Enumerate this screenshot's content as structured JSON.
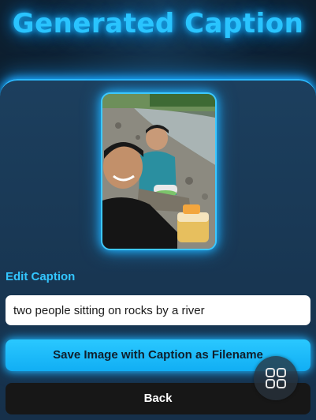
{
  "header": {
    "title": "Generated Caption"
  },
  "editor": {
    "label": "Edit Caption",
    "caption_value": "two people sitting on rocks by a river"
  },
  "actions": {
    "save_label": "Save Image with Caption as Filename",
    "back_label": "Back"
  },
  "icons": {
    "floating_button": "grid-icon"
  },
  "colors": {
    "accent": "#29c4ff",
    "card_bg": "#1c3f5e",
    "save_button": "#1db9f8",
    "back_button": "#171717"
  }
}
